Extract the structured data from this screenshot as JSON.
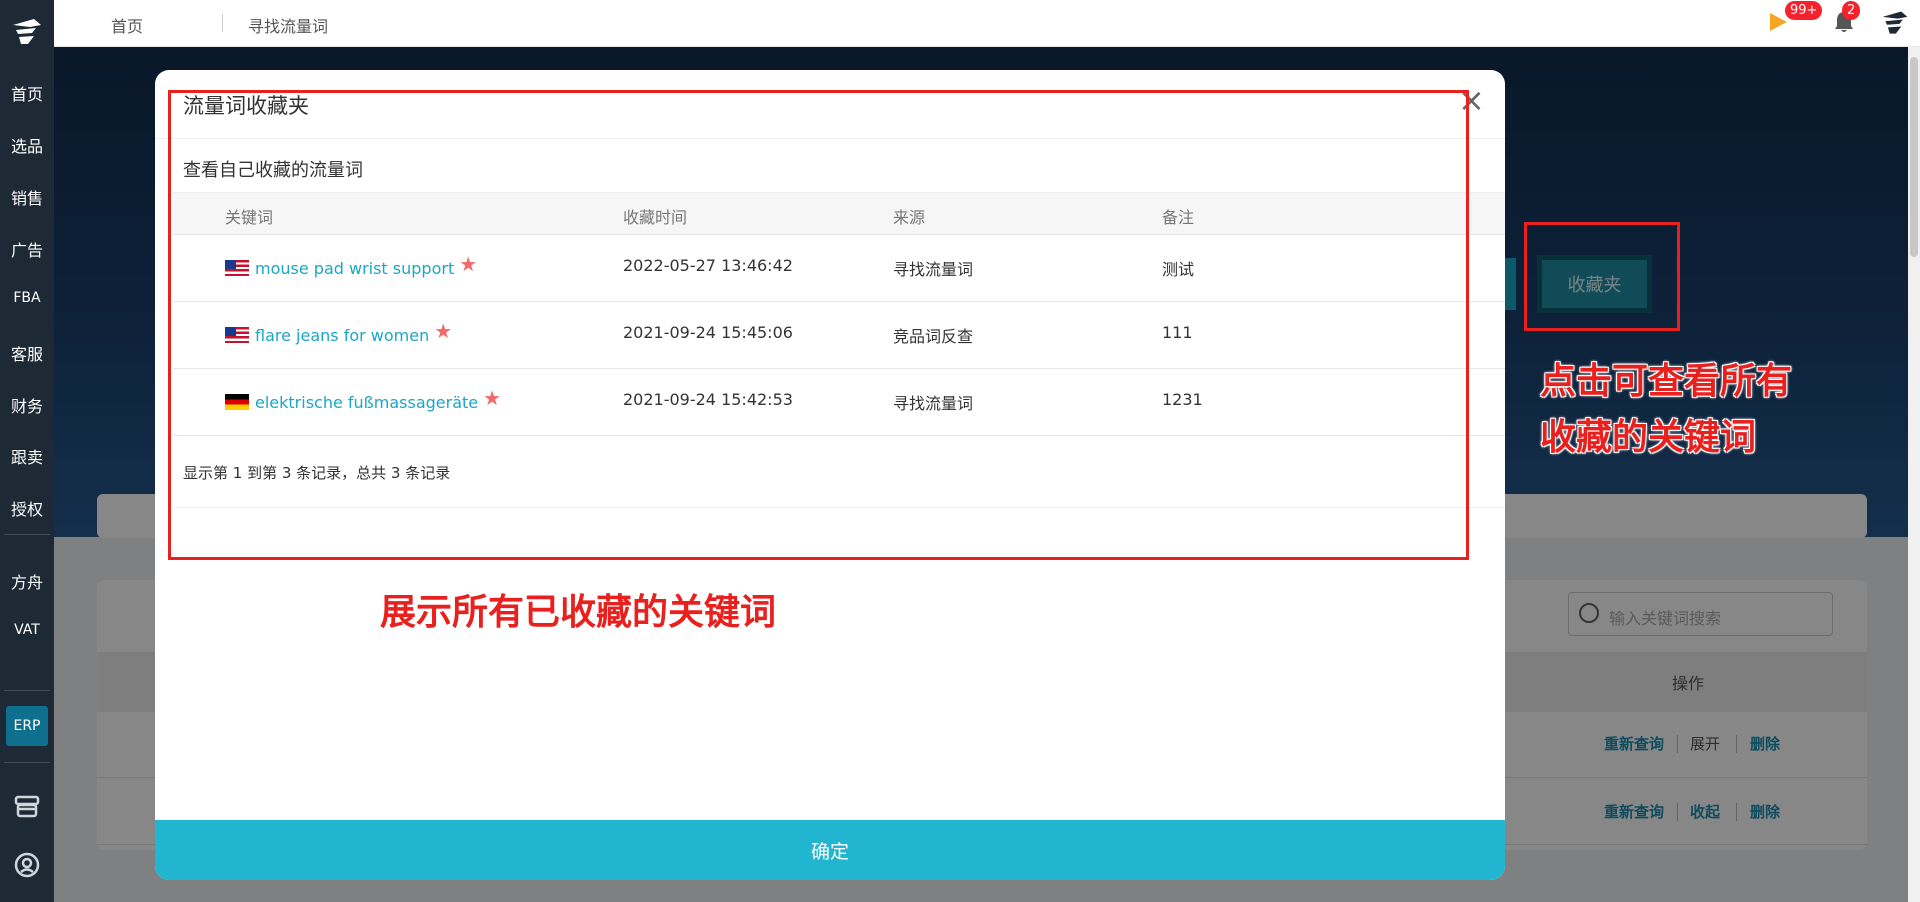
{
  "sidebar": {
    "logo_icon": "brand-logo-icon",
    "items": [
      {
        "label": "首页"
      },
      {
        "label": "选品"
      },
      {
        "label": "销售"
      },
      {
        "label": "广告"
      },
      {
        "label": "FBA"
      },
      {
        "label": "客服"
      },
      {
        "label": "财务"
      },
      {
        "label": "跟卖"
      },
      {
        "label": "授权"
      },
      {
        "label": "方舟"
      },
      {
        "label": "VAT"
      }
    ],
    "erp_label": "ERP",
    "bottom_icons": [
      "store-icon",
      "support-icon"
    ]
  },
  "topbar": {
    "breadcrumbs": [
      "首页",
      "寻找流量词"
    ],
    "flag_badge": "99+",
    "bell_badge": "2",
    "icons": [
      "flag-icon",
      "bell-icon",
      "user-avatar-icon"
    ]
  },
  "background_page": {
    "favorites_button": "收藏夹",
    "search_placeholder": "输入关键词搜索",
    "actions_header": "操作",
    "rows": [
      {
        "act1": "重新查询",
        "act2": "展开",
        "act3": "删除"
      },
      {
        "act1": "重新查询",
        "act2": "收起",
        "act3": "删除"
      }
    ]
  },
  "annotations": {
    "right_note_line1": "点击可查看所有",
    "right_note_line2": "收藏的关键词",
    "bottom_note": "展示所有已收藏的关键词",
    "color": "#e8211f"
  },
  "modal": {
    "title": "流量词收藏夹",
    "close": "×",
    "subtitle": "查看自己收藏的流量词",
    "columns": {
      "keyword": "关键词",
      "time": "收藏时间",
      "source": "来源",
      "note": "备注"
    },
    "rows": [
      {
        "flag": "us",
        "keyword": "mouse pad wrist support",
        "time": "2022-05-27 13:46:42",
        "source": "寻找流量词",
        "note": "测试"
      },
      {
        "flag": "us",
        "keyword": "flare jeans for women",
        "time": "2021-09-24 15:45:06",
        "source": "竞品词反查",
        "note": "111"
      },
      {
        "flag": "de",
        "keyword": "elektrische fußmassageräte",
        "time": "2021-09-24 15:42:53",
        "source": "寻找流量词",
        "note": "1231"
      }
    ],
    "pager": "显示第 1 到第 3 条记录，总共 3 条记录",
    "confirm": "确定",
    "accent": "#22b5cf"
  }
}
